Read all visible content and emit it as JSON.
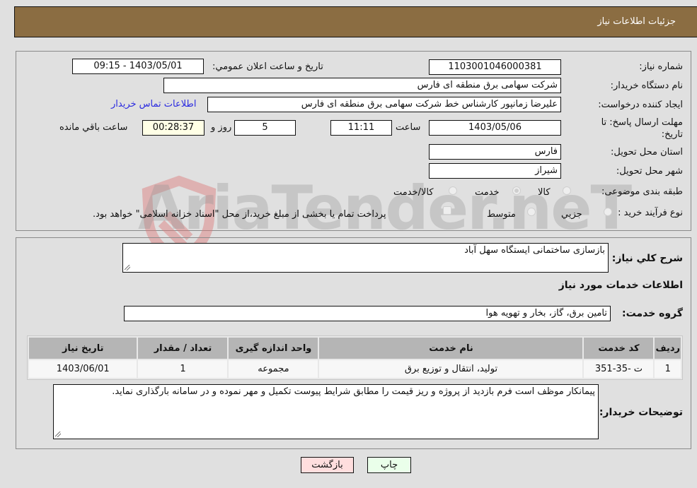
{
  "header": {
    "title": "جزئیات اطلاعات نیاز"
  },
  "form": {
    "need_number": {
      "label": "شماره نیاز:",
      "value": "1103001046000381"
    },
    "announce": {
      "label": "تاریخ و ساعت اعلان عمومي:",
      "value": "1403/05/01 - 09:15"
    },
    "buyer_org": {
      "label": "نام دستگاه خریدار:",
      "value": "شرکت سهامی برق منطقه ای فارس"
    },
    "creator": {
      "label": "ایجاد کننده درخواست:",
      "value": "علیرضا زمانپور کارشناس خط شرکت سهامی برق منطقه ای فارس",
      "contact_link": "اطلاعات تماس خریدار"
    },
    "deadline": {
      "label": "مهلت ارسال پاسخ: تا تاریخ:",
      "date": "1403/05/06",
      "time_label": "ساعت",
      "time": "11:11",
      "days": "5",
      "days_label": "روز و",
      "remaining": "00:28:37",
      "remaining_label": "ساعت باقي مانده"
    },
    "province": {
      "label": "استان محل تحویل:",
      "value": "فارس"
    },
    "city": {
      "label": "شهر محل تحویل:",
      "value": "شیراز"
    },
    "category": {
      "label": "طبقه بندی موضوعی:",
      "options": [
        {
          "label": "کالا",
          "checked": false
        },
        {
          "label": "خدمت",
          "checked": true
        },
        {
          "label": "کالا/خدمت",
          "checked": false
        }
      ]
    },
    "process": {
      "label": "نوع فرآیند خرید :",
      "options": [
        {
          "label": "جزيي",
          "checked": false
        },
        {
          "label": "متوسط",
          "checked": false
        }
      ],
      "treasury_note": "پرداخت تمام یا بخشی از مبلغ خرید،از محل \"اسناد خزانه اسلامی\" خواهد بود."
    }
  },
  "details": {
    "summary_label": "شرح کلي نیاز:",
    "summary_value": "بازسازی ساختمانی ایستگاه سهل آباد",
    "services_heading": "اطلاعات خدمات مورد نیاز",
    "service_group_label": "گروه خدمت:",
    "service_group_value": "تامین برق، گاز، بخار و تهویه هوا",
    "table": {
      "headers": [
        "ردیف",
        "کد خدمت",
        "نام خدمت",
        "واحد اندازه گیری",
        "تعداد / مقدار",
        "تاریخ نیاز"
      ],
      "rows": [
        [
          "1",
          "ت -35-351",
          "تولید، انتقال و توزیع برق",
          "مجموعه",
          "1",
          "1403/06/01"
        ]
      ]
    },
    "buyer_notes_label": "توضیحات خریدار:",
    "buyer_notes_value": "پیمانکار موظف است فرم بازدید از پروژه و ریز قیمت را مطابق شرایط پیوست تکمیل و مهر نموده و در سامانه بارگذاری نماید."
  },
  "buttons": {
    "print": "چاپ",
    "back": "بازگشت"
  },
  "watermark": {
    "text": "AriaTender.neT"
  },
  "colors": {
    "header_bg": "#8b6d42",
    "print_bg": "#eaffea",
    "back_bg": "#ffdede",
    "link": "#2a2ae0"
  }
}
